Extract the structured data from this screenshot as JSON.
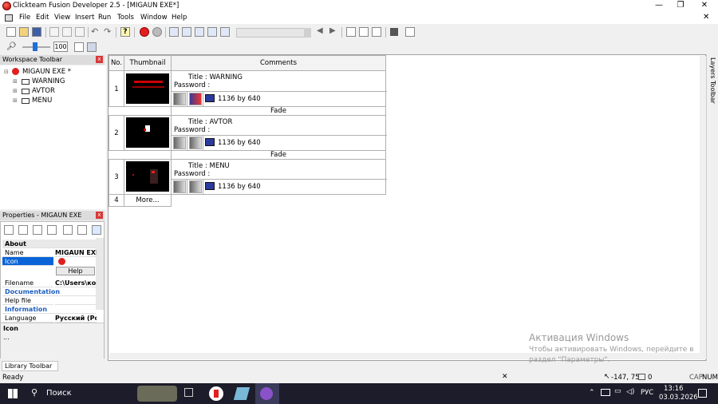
{
  "window": {
    "title": "Clickteam Fusion Developer 2.5 - [MIGAUN EXE*]",
    "min_label": "—",
    "restore_label": "❐",
    "close_label": "✕"
  },
  "menu": [
    "File",
    "Edit",
    "View",
    "Insert",
    "Run",
    "Tools",
    "Window",
    "Help"
  ],
  "toolbar": {
    "zoom_value": "100"
  },
  "workspace": {
    "title": "Workspace Toolbar",
    "root": "MIGAUN EXE *",
    "frames": [
      "WARNING",
      "AVTOR",
      "MENU"
    ]
  },
  "properties": {
    "title": "Properties - MIGAUN EXE",
    "rows": [
      {
        "key": "About",
        "val": "",
        "cat": true
      },
      {
        "key": "Name",
        "val": "MIGAUN EXE",
        "cat": false
      },
      {
        "key": "Icon",
        "val": "",
        "cat": false,
        "selected": true
      },
      {
        "key": "",
        "val": "Help",
        "cat": false
      },
      {
        "key": "Filename",
        "val": "C:\\Users\\ком",
        "cat": false
      },
      {
        "key": "Documentation",
        "val": "",
        "cat": true
      },
      {
        "key": "Help file",
        "val": "",
        "cat": false
      },
      {
        "key": "Information",
        "val": "",
        "cat": true
      },
      {
        "key": "Language",
        "val": "Русский (Рос",
        "cat": false
      }
    ],
    "desc_title": "Icon",
    "desc_text": "..."
  },
  "storyboard": {
    "headers": [
      "No.",
      "Thumbnail",
      "Comments"
    ],
    "frames": [
      {
        "no": "1",
        "title": "Title : WARNING",
        "password": "Password :",
        "size": "1136 by 640",
        "transition": "Fade"
      },
      {
        "no": "2",
        "title": "Title : AVTOR",
        "password": "Password :",
        "size": "1136 by 640",
        "transition": "Fade"
      },
      {
        "no": "3",
        "title": "Title : MENU",
        "password": "Password :",
        "size": "1136 by 640",
        "transition": ""
      }
    ],
    "more_no": "4",
    "more_label": "More..."
  },
  "layers_label": "Layers Toolbar",
  "library_tab": "Library Toolbar",
  "watermark": {
    "title": "Активация Windows",
    "line1": "Чтобы активировать Windows, перейдите в",
    "line2": "раздел \"Параметры\"."
  },
  "status": {
    "ready": "Ready",
    "coords": "-147, 75",
    "zero": "0",
    "caps": "CAP",
    "num": "NUM"
  },
  "taskbar": {
    "search": "Поиск",
    "lang": "РУС",
    "time": "13:16",
    "date": "03.03.2026"
  }
}
